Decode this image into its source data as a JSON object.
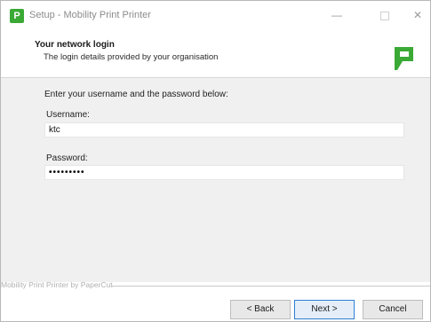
{
  "window": {
    "title": "Setup - Mobility Print Printer",
    "app_icon_letter": "P",
    "controls": {
      "minimize": "—",
      "close": "✕"
    }
  },
  "header": {
    "title": "Your network login",
    "subtitle": "The login details provided by your organisation",
    "logo_icon": "papercut-logo-icon"
  },
  "form": {
    "instruction": "Enter your username and the password below:",
    "username_label": "Username:",
    "username_value": "ktc",
    "password_label": "Password:",
    "password_value": "•••••••••"
  },
  "footer": {
    "brand": "Mobility Print Printer by PaperCut",
    "back_label": "< Back",
    "next_label": "Next >",
    "cancel_label": "Cancel"
  },
  "colors": {
    "accent": "#3aa935",
    "focus": "#2f7fd4"
  }
}
